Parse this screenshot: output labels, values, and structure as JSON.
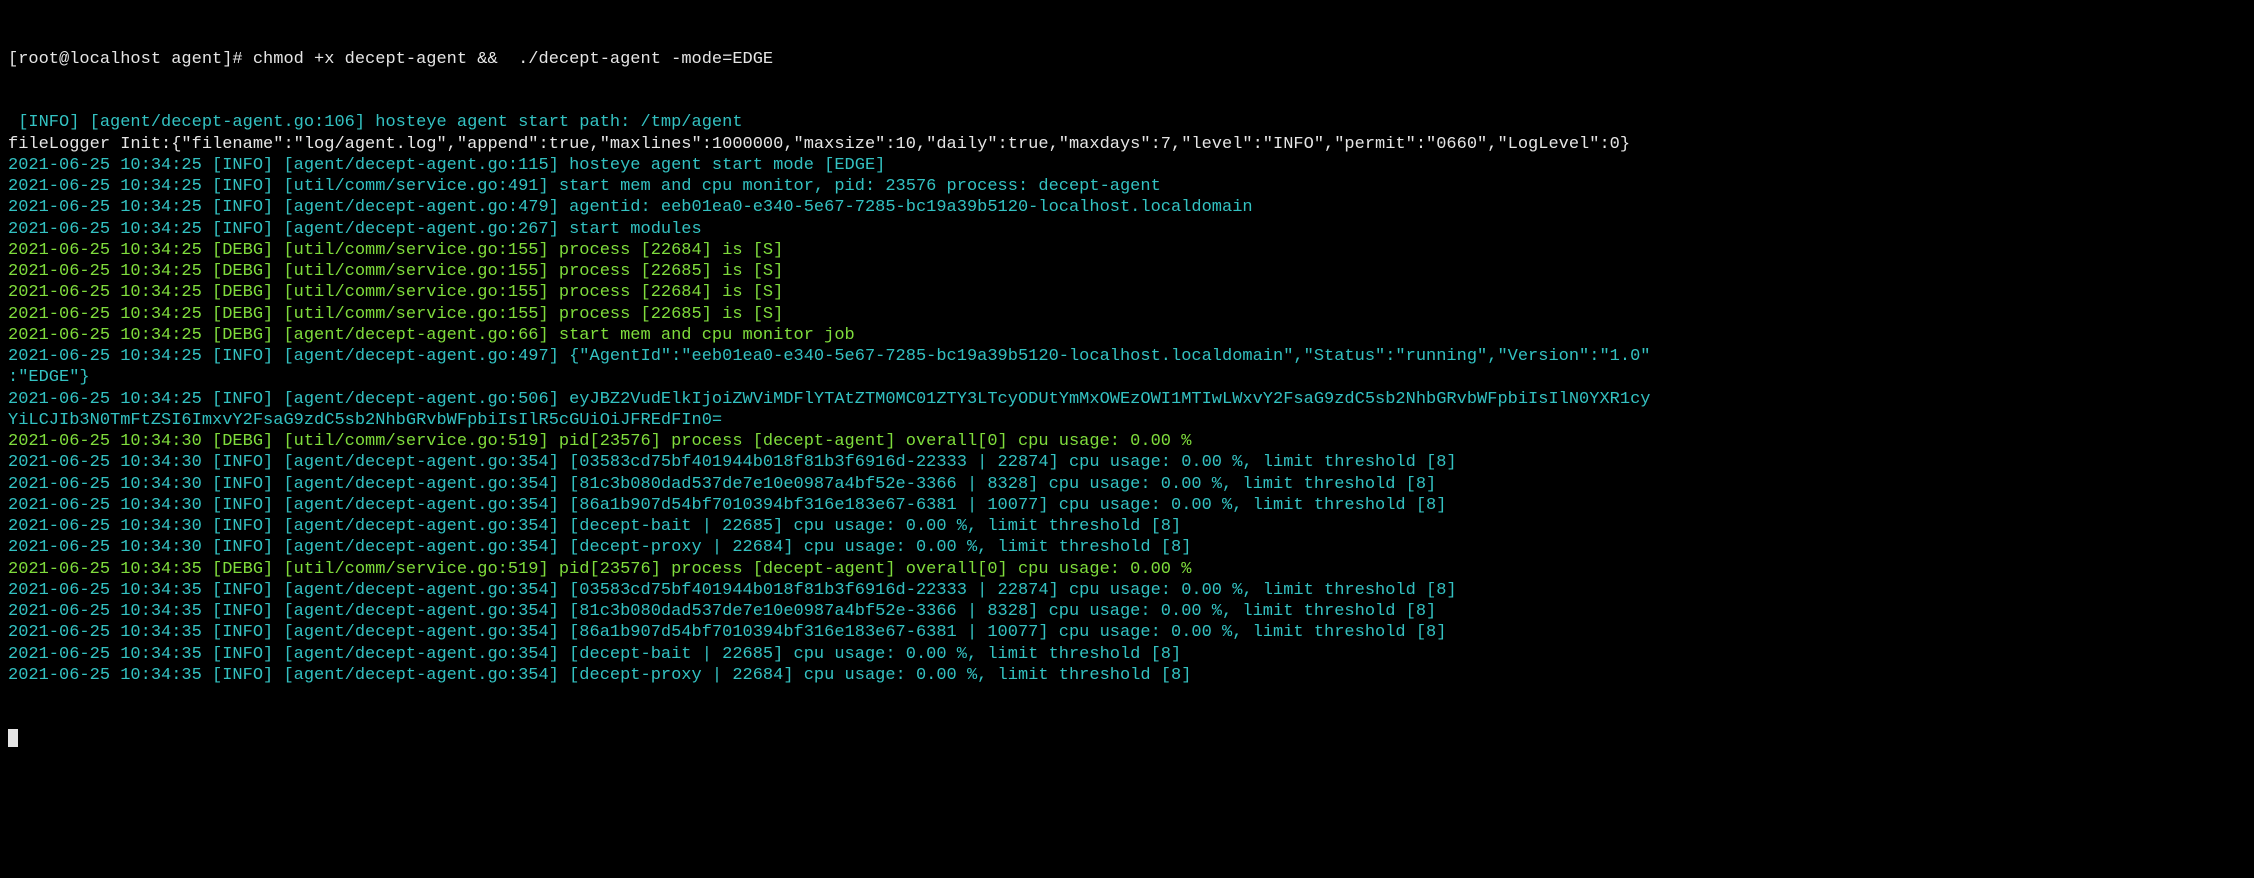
{
  "prompt": {
    "user_host_path": "[root@localhost agent]# ",
    "command": "chmod +x decept-agent &&  ./decept-agent -mode=EDGE"
  },
  "lines": [
    {
      "c": "teal",
      "t": " [INFO] [agent/decept-agent.go:106] hosteye agent start path: /tmp/agent"
    },
    {
      "c": "white",
      "t": "fileLogger Init:{\"filename\":\"log/agent.log\",\"append\":true,\"maxlines\":1000000,\"maxsize\":10,\"daily\":true,\"maxdays\":7,\"level\":\"INFO\",\"permit\":\"0660\",\"LogLevel\":0}"
    },
    {
      "c": "teal",
      "t": "2021-06-25 10:34:25 [INFO] [agent/decept-agent.go:115] hosteye agent start mode [EDGE]"
    },
    {
      "c": "teal",
      "t": "2021-06-25 10:34:25 [INFO] [util/comm/service.go:491] start mem and cpu monitor, pid: 23576 process: decept-agent"
    },
    {
      "c": "teal",
      "t": "2021-06-25 10:34:25 [INFO] [agent/decept-agent.go:479] agentid: eeb01ea0-e340-5e67-7285-bc19a39b5120-localhost.localdomain"
    },
    {
      "c": "teal",
      "t": "2021-06-25 10:34:25 [INFO] [agent/decept-agent.go:267] start modules"
    },
    {
      "c": "green",
      "t": "2021-06-25 10:34:25 [DEBG] [util/comm/service.go:155] process [22684] is [S]"
    },
    {
      "c": "green",
      "t": "2021-06-25 10:34:25 [DEBG] [util/comm/service.go:155] process [22685] is [S]"
    },
    {
      "c": "green",
      "t": "2021-06-25 10:34:25 [DEBG] [util/comm/service.go:155] process [22684] is [S]"
    },
    {
      "c": "green",
      "t": "2021-06-25 10:34:25 [DEBG] [util/comm/service.go:155] process [22685] is [S]"
    },
    {
      "c": "green",
      "t": "2021-06-25 10:34:25 [DEBG] [agent/decept-agent.go:66] start mem and cpu monitor job"
    },
    {
      "c": "teal",
      "t": "2021-06-25 10:34:25 [INFO] [agent/decept-agent.go:497] {\"AgentId\":\"eeb01ea0-e340-5e67-7285-bc19a39b5120-localhost.localdomain\",\"Status\":\"running\",\"Version\":\"1.0\""
    },
    {
      "c": "teal",
      "t": ":\"EDGE\"}"
    },
    {
      "c": "teal",
      "t": "2021-06-25 10:34:25 [INFO] [agent/decept-agent.go:506] eyJBZ2VudElkIjoiZWViMDFlYTAtZTM0MC01ZTY3LTcyODUtYmMxOWEzOWI1MTIwLWxvY2FsaG9zdC5sb2NhbGRvbWFpbiIsIlN0YXR1cy"
    },
    {
      "c": "teal",
      "t": "YiLCJIb3N0TmFtZSI6ImxvY2FsaG9zdC5sb2NhbGRvbWFpbiIsIlR5cGUiOiJFREdFIn0="
    },
    {
      "c": "green",
      "t": "2021-06-25 10:34:30 [DEBG] [util/comm/service.go:519] pid[23576] process [decept-agent] overall[0] cpu usage: 0.00 %"
    },
    {
      "c": "teal",
      "t": "2021-06-25 10:34:30 [INFO] [agent/decept-agent.go:354] [03583cd75bf401944b018f81b3f6916d-22333 | 22874] cpu usage: 0.00 %, limit threshold [8]"
    },
    {
      "c": "teal",
      "t": "2021-06-25 10:34:30 [INFO] [agent/decept-agent.go:354] [81c3b080dad537de7e10e0987a4bf52e-3366 | 8328] cpu usage: 0.00 %, limit threshold [8]"
    },
    {
      "c": "teal",
      "t": "2021-06-25 10:34:30 [INFO] [agent/decept-agent.go:354] [86a1b907d54bf7010394bf316e183e67-6381 | 10077] cpu usage: 0.00 %, limit threshold [8]"
    },
    {
      "c": "teal",
      "t": "2021-06-25 10:34:30 [INFO] [agent/decept-agent.go:354] [decept-bait | 22685] cpu usage: 0.00 %, limit threshold [8]"
    },
    {
      "c": "teal",
      "t": "2021-06-25 10:34:30 [INFO] [agent/decept-agent.go:354] [decept-proxy | 22684] cpu usage: 0.00 %, limit threshold [8]"
    },
    {
      "c": "green",
      "t": "2021-06-25 10:34:35 [DEBG] [util/comm/service.go:519] pid[23576] process [decept-agent] overall[0] cpu usage: 0.00 %"
    },
    {
      "c": "teal",
      "t": "2021-06-25 10:34:35 [INFO] [agent/decept-agent.go:354] [03583cd75bf401944b018f81b3f6916d-22333 | 22874] cpu usage: 0.00 %, limit threshold [8]"
    },
    {
      "c": "teal",
      "t": "2021-06-25 10:34:35 [INFO] [agent/decept-agent.go:354] [81c3b080dad537de7e10e0987a4bf52e-3366 | 8328] cpu usage: 0.00 %, limit threshold [8]"
    },
    {
      "c": "teal",
      "t": "2021-06-25 10:34:35 [INFO] [agent/decept-agent.go:354] [86a1b907d54bf7010394bf316e183e67-6381 | 10077] cpu usage: 0.00 %, limit threshold [8]"
    },
    {
      "c": "teal",
      "t": "2021-06-25 10:34:35 [INFO] [agent/decept-agent.go:354] [decept-bait | 22685] cpu usage: 0.00 %, limit threshold [8]"
    },
    {
      "c": "teal",
      "t": "2021-06-25 10:34:35 [INFO] [agent/decept-agent.go:354] [decept-proxy | 22684] cpu usage: 0.00 %, limit threshold [8]"
    }
  ]
}
